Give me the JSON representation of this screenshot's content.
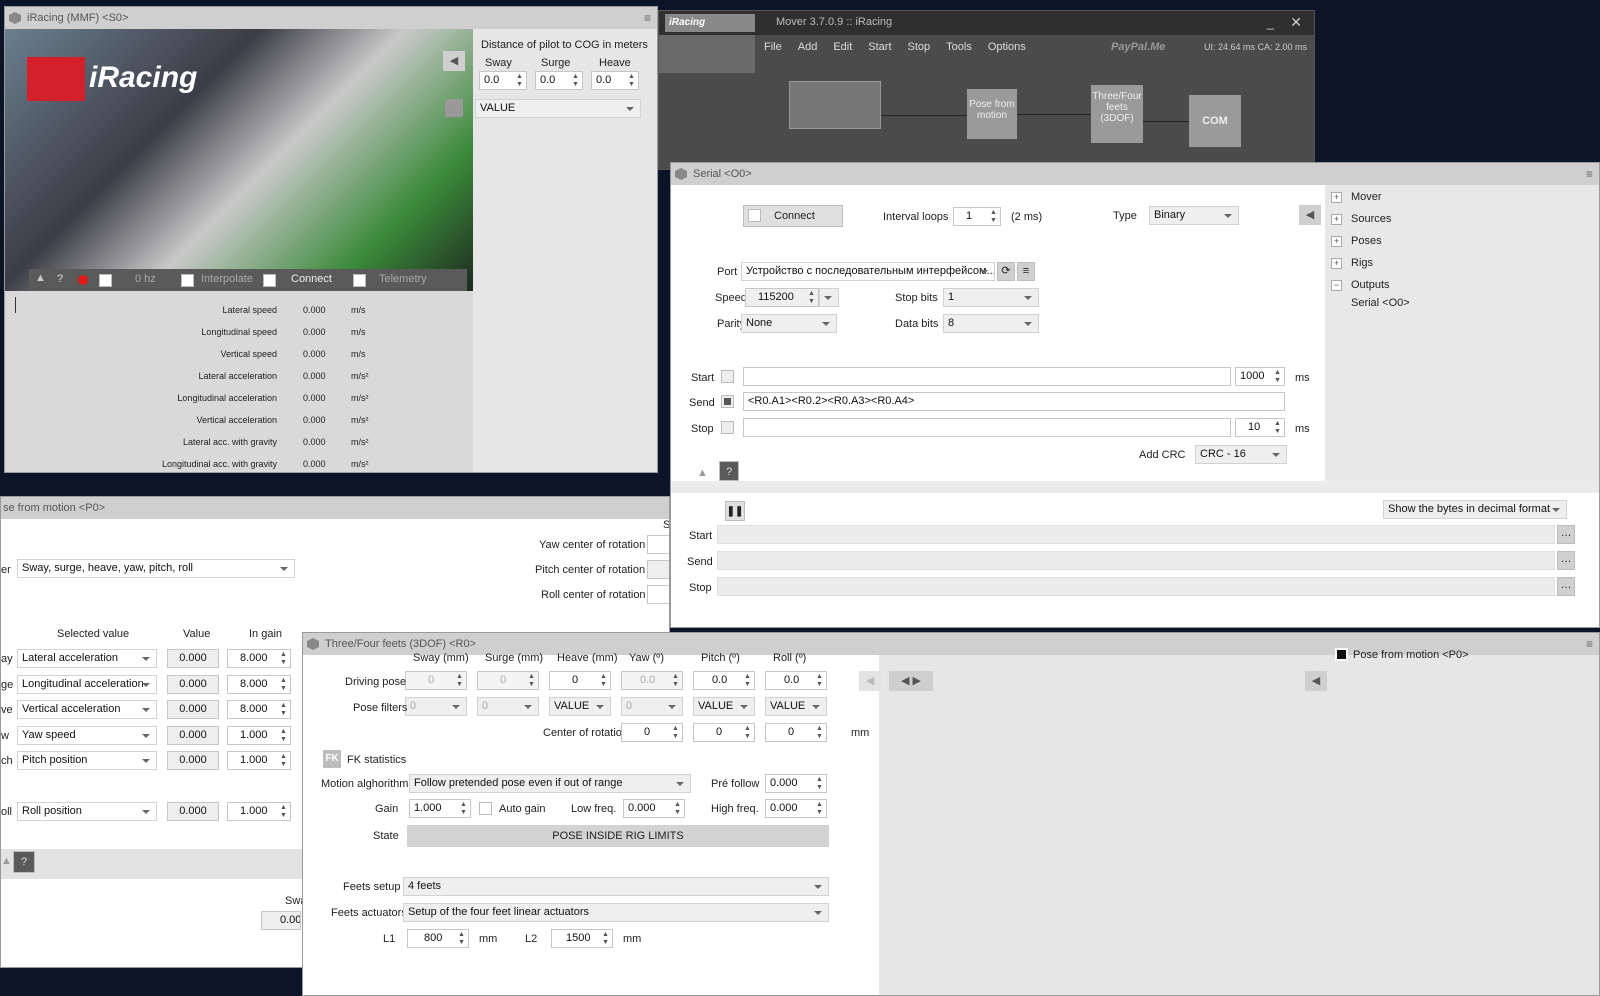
{
  "desktop": {
    "bg": "#0c1528"
  },
  "iracing": {
    "title": "iRacing (MMF) <S0>",
    "logo": "iRacing",
    "cog_title": "Distance of pilot to COG in meters",
    "cog_cols": [
      {
        "label": "Sway",
        "value": "0.0"
      },
      {
        "label": "Surge",
        "value": "0.0"
      },
      {
        "label": "Heave",
        "value": "0.0"
      }
    ],
    "value_select": "VALUE",
    "toolbar": {
      "help": "?",
      "hz": "0 hz",
      "interpolate": "Interpolate",
      "connect": "Connect",
      "telemetry": "Telemetry"
    },
    "telemetry": [
      {
        "label": "Lateral speed",
        "value": "0.000",
        "unit": "m/s"
      },
      {
        "label": "Longitudinal speed",
        "value": "0.000",
        "unit": "m/s"
      },
      {
        "label": "Vertical speed",
        "value": "0.000",
        "unit": "m/s"
      },
      {
        "label": "Lateral acceleration",
        "value": "0.000",
        "unit": "m/s²"
      },
      {
        "label": "Longitudinal acceleration",
        "value": "0.000",
        "unit": "m/s²"
      },
      {
        "label": "Vertical acceleration",
        "value": "0.000",
        "unit": "m/s²"
      },
      {
        "label": "Lateral acc. with gravity",
        "value": "0.000",
        "unit": "m/s²"
      },
      {
        "label": "Longitudinal acc. with gravity",
        "value": "0.000",
        "unit": "m/s²"
      }
    ]
  },
  "mover": {
    "title": "Mover 3.7.0.9 :: iRacing",
    "menu": [
      "File",
      "Add",
      "Edit",
      "Start",
      "Stop",
      "Tools",
      "Options"
    ],
    "paypal": "PayPal.Me",
    "stats": "UI: 24.64 ms   CA: 2.00 ms",
    "nodes": {
      "pose": "Pose from motion",
      "three": "Three/Four feets (3DOF)",
      "com": "COM"
    }
  },
  "serial": {
    "title": "Serial <O0>",
    "connect": "Connect",
    "interval_label": "Interval loops",
    "interval": "1",
    "interval_ms": "(2 ms)",
    "type_label": "Type",
    "type": "Binary",
    "port_label": "Port",
    "port": "Устройство с последовательным интерфейсом...",
    "speed_label": "Speed",
    "speed": "115200",
    "stopbits_label": "Stop bits",
    "stopbits": "1",
    "parity_label": "Parity",
    "parity": "None",
    "databits_label": "Data bits",
    "databits": "8",
    "start_label": "Start",
    "start_ms": "1000",
    "ms": "ms",
    "send_label": "Send",
    "send": "<R0.A1><R0.2><R0.A3><R0.A4>",
    "stop_label": "Stop",
    "stop_ms": "10",
    "crc_label": "Add CRC",
    "crc": "CRC - 16",
    "help": "?",
    "bytes_format": "Show the bytes in decimal format",
    "tree": [
      {
        "label": "Mover",
        "sign": "+"
      },
      {
        "label": "Sources",
        "sign": "+"
      },
      {
        "label": "Poses",
        "sign": "+"
      },
      {
        "label": "Rigs",
        "sign": "+"
      },
      {
        "label": "Outputs",
        "sign": "−"
      }
    ],
    "tree_child": "Serial <O0>"
  },
  "posewin": {
    "title": "se from motion <P0>",
    "filter_prefix": "er",
    "filter": "Sway, surge, heave, yaw, pitch, roll",
    "centers": [
      "Yaw center of rotation",
      "Pitch center of rotation",
      "Roll center of rotation"
    ],
    "headers": {
      "selected": "Selected value",
      "value": "Value",
      "gain": "In gain"
    },
    "rows": [
      {
        "prefix": "ay",
        "sel": "Lateral acceleration",
        "value": "0.000",
        "gain": "8.000"
      },
      {
        "prefix": "ge",
        "sel": "Longitudinal acceleration",
        "value": "0.000",
        "gain": "8.000"
      },
      {
        "prefix": "ve",
        "sel": "Vertical acceleration",
        "value": "0.000",
        "gain": "8.000"
      },
      {
        "prefix": "w",
        "sel": "Yaw speed",
        "value": "0.000",
        "gain": "1.000"
      },
      {
        "prefix": "ch",
        "sel": "Pitch position",
        "value": "0.000",
        "gain": "1.000"
      },
      {
        "prefix": "oll",
        "sel": "Roll position",
        "value": "0.000",
        "gain": "1.000"
      }
    ],
    "help": "?",
    "sway_short": "Swa",
    "sway_val": "0.00",
    "s_short": "S"
  },
  "three": {
    "title": "Three/Four feets (3DOF) <R0>",
    "cols": [
      "Sway (mm)",
      "Surge (mm)",
      "Heave (mm)",
      "Yaw (º)",
      "Pitch (º)",
      "Roll (º)"
    ],
    "driving_label": "Driving pose",
    "driving": [
      "0",
      "0",
      "0",
      "0.0",
      "0.0",
      "0.0"
    ],
    "filters_label": "Pose filters",
    "filters": [
      "0",
      "0",
      "VALUE",
      "0",
      "VALUE",
      "VALUE"
    ],
    "cor_label": "Center of rotation",
    "cor": [
      "0",
      "0",
      "0"
    ],
    "mm": "mm",
    "fk": "FK",
    "fk_stats": "FK statistics",
    "algo_label": "Motion alghorithm",
    "algo": "Follow pretended pose even if out of range",
    "prefollow_label": "Pré follow",
    "prefollow": "0.000",
    "gain_label": "Gain",
    "gain": "1.000",
    "autogain": "Auto gain",
    "lowfreq_label": "Low freq.",
    "lowfreq": "0.000",
    "highfreq_label": "High freq.",
    "highfreq": "0.000",
    "state_label": "State",
    "state": "POSE INSIDE RIG LIMITS",
    "setup_label": "Feets setup",
    "setup": "4 feets",
    "act_label": "Feets actuators",
    "act": "Setup of the four feet linear actuators",
    "l1_label": "L1",
    "l1": "800",
    "l2_label": "L2",
    "l2": "1500",
    "side_item": "Pose from motion <P0>"
  }
}
